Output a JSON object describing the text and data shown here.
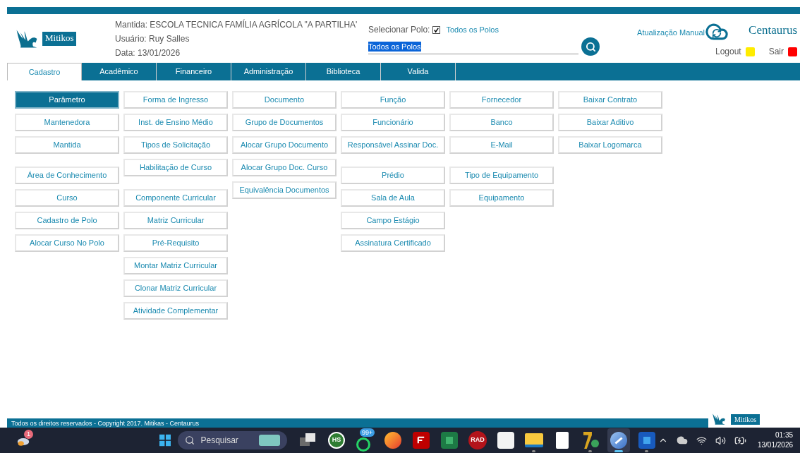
{
  "header": {
    "logo_text": "Mitikos",
    "mantida": "Mantida: ESCOLA TECNICA FAMÍLIA AGRÍCOLA \"A PARTILHA'",
    "usuario": "Usuário: Ruy Salles",
    "data": "Data: 13/01/2026"
  },
  "polo": {
    "label": "Selecionar Polo:",
    "all_checked": true,
    "all_label": "Todos os Polos",
    "value": "Todos os Polos"
  },
  "sync": {
    "label": "Atualização Manual"
  },
  "brand": "Centaurus",
  "session": [
    {
      "label": "Logout",
      "color": "#ffec00"
    },
    {
      "label": "Sair",
      "color": "#ff0000"
    }
  ],
  "tabs": [
    {
      "label": "Cadastro",
      "selected": true
    },
    {
      "label": "Acadêmico",
      "selected": false
    },
    {
      "label": "Financeiro",
      "selected": false
    },
    {
      "label": "Administração",
      "selected": false
    },
    {
      "label": "Biblioteca",
      "selected": false
    },
    {
      "label": "Valida",
      "selected": false
    }
  ],
  "menu_columns": [
    {
      "groups": [
        {
          "items": [
            {
              "label": "Parâmetro",
              "selected": true
            },
            {
              "label": "Mantenedora",
              "selected": false
            },
            {
              "label": "Mantida",
              "selected": false
            }
          ]
        },
        {
          "items": [
            {
              "label": "Área de Conhecimento",
              "selected": false
            },
            {
              "label": "Curso",
              "selected": false
            },
            {
              "label": "Cadastro de Polo",
              "selected": false
            },
            {
              "label": "Alocar Curso No Polo",
              "selected": false
            }
          ]
        }
      ]
    },
    {
      "groups": [
        {
          "items": [
            {
              "label": "Forma de Ingresso",
              "selected": false
            },
            {
              "label": "Inst. de Ensino Médio",
              "selected": false
            },
            {
              "label": "Tipos de Solicitação",
              "selected": false
            },
            {
              "label": "Habilitação de Curso",
              "selected": false
            }
          ]
        },
        {
          "items": [
            {
              "label": "Componente Curricular",
              "selected": false
            },
            {
              "label": "Matriz Curricular",
              "selected": false
            },
            {
              "label": "Pré-Requisito",
              "selected": false
            },
            {
              "label": "Montar Matriz Curricular",
              "selected": false
            },
            {
              "label": "Clonar Matriz Curricular",
              "selected": false
            },
            {
              "label": "Atividade Complementar",
              "selected": false
            }
          ]
        }
      ]
    },
    {
      "groups": [
        {
          "items": [
            {
              "label": "Documento",
              "selected": false
            },
            {
              "label": "Grupo de Documentos",
              "selected": false
            },
            {
              "label": "Alocar Grupo Documento",
              "selected": false
            },
            {
              "label": "Alocar Grupo Doc. Curso",
              "selected": false
            },
            {
              "label": "Equivalência Documentos",
              "selected": false
            }
          ]
        }
      ]
    },
    {
      "groups": [
        {
          "items": [
            {
              "label": "Função",
              "selected": false
            },
            {
              "label": "Funcionário",
              "selected": false
            },
            {
              "label": "Responsável Assinar Doc.",
              "selected": false
            }
          ]
        },
        {
          "items": [
            {
              "label": "Prédio",
              "selected": false
            },
            {
              "label": "Sala de Aula",
              "selected": false
            },
            {
              "label": "Campo Estágio",
              "selected": false
            },
            {
              "label": "Assinatura Certificado",
              "selected": false
            }
          ]
        }
      ]
    },
    {
      "groups": [
        {
          "items": [
            {
              "label": "Fornecedor",
              "selected": false
            },
            {
              "label": "Banco",
              "selected": false
            },
            {
              "label": "E-Mail",
              "selected": false
            }
          ]
        },
        {
          "items": [
            {
              "label": "Tipo de Equipamento",
              "selected": false
            },
            {
              "label": "Equipamento",
              "selected": false
            }
          ]
        }
      ]
    },
    {
      "groups": [
        {
          "items": [
            {
              "label": "Baixar Contrato",
              "selected": false
            },
            {
              "label": "Baixar Aditivo",
              "selected": false
            },
            {
              "label": "Baixar Logomarca",
              "selected": false
            }
          ]
        }
      ]
    }
  ],
  "footer": {
    "copyright": "Todos os direitos reservados - Copyright 2017. Mitikas - Centaurus",
    "logo_text": "Mitikos"
  },
  "taskbar": {
    "weather_badge": "1",
    "search_placeholder": "Pesquisar",
    "apps": [
      {
        "kind": "taskview",
        "running": false,
        "selected": false
      },
      {
        "kind": "hs",
        "label": "HS",
        "running": false,
        "selected": false
      },
      {
        "kind": "whatsapp",
        "badge": "99+",
        "running": false,
        "selected": false
      },
      {
        "kind": "firefox",
        "running": false,
        "selected": false
      },
      {
        "kind": "filezilla",
        "running": false,
        "selected": false
      },
      {
        "kind": "excel",
        "running": false,
        "selected": false
      },
      {
        "kind": "rad",
        "label": "RAD",
        "running": false,
        "selected": false
      },
      {
        "kind": "store",
        "running": false,
        "selected": false
      },
      {
        "kind": "explorer",
        "running": true,
        "selected": false
      },
      {
        "kind": "file",
        "running": false,
        "selected": false
      },
      {
        "kind": "seven",
        "running": true,
        "selected": false
      },
      {
        "kind": "browser",
        "running": true,
        "selected": true
      },
      {
        "kind": "word",
        "running": true,
        "selected": false
      }
    ],
    "time": "01:35",
    "date": "13/01/2026"
  }
}
